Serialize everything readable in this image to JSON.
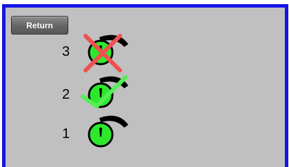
{
  "toolbar": {
    "return_label": "Return"
  },
  "levels": [
    {
      "number": "3",
      "status": "rejected",
      "mark_icon": "red-x"
    },
    {
      "number": "2",
      "status": "confirmed",
      "mark_icon": "green-check"
    },
    {
      "number": "1",
      "status": "plain",
      "mark_icon": ""
    }
  ],
  "colors": {
    "panel_background": "#c0c0c0",
    "panel_border": "#1414e6",
    "gauge_fill": "#2ee82e",
    "gauge_outline": "#000000",
    "x_mark": "#f05050",
    "check_mark": "#55ee55"
  }
}
